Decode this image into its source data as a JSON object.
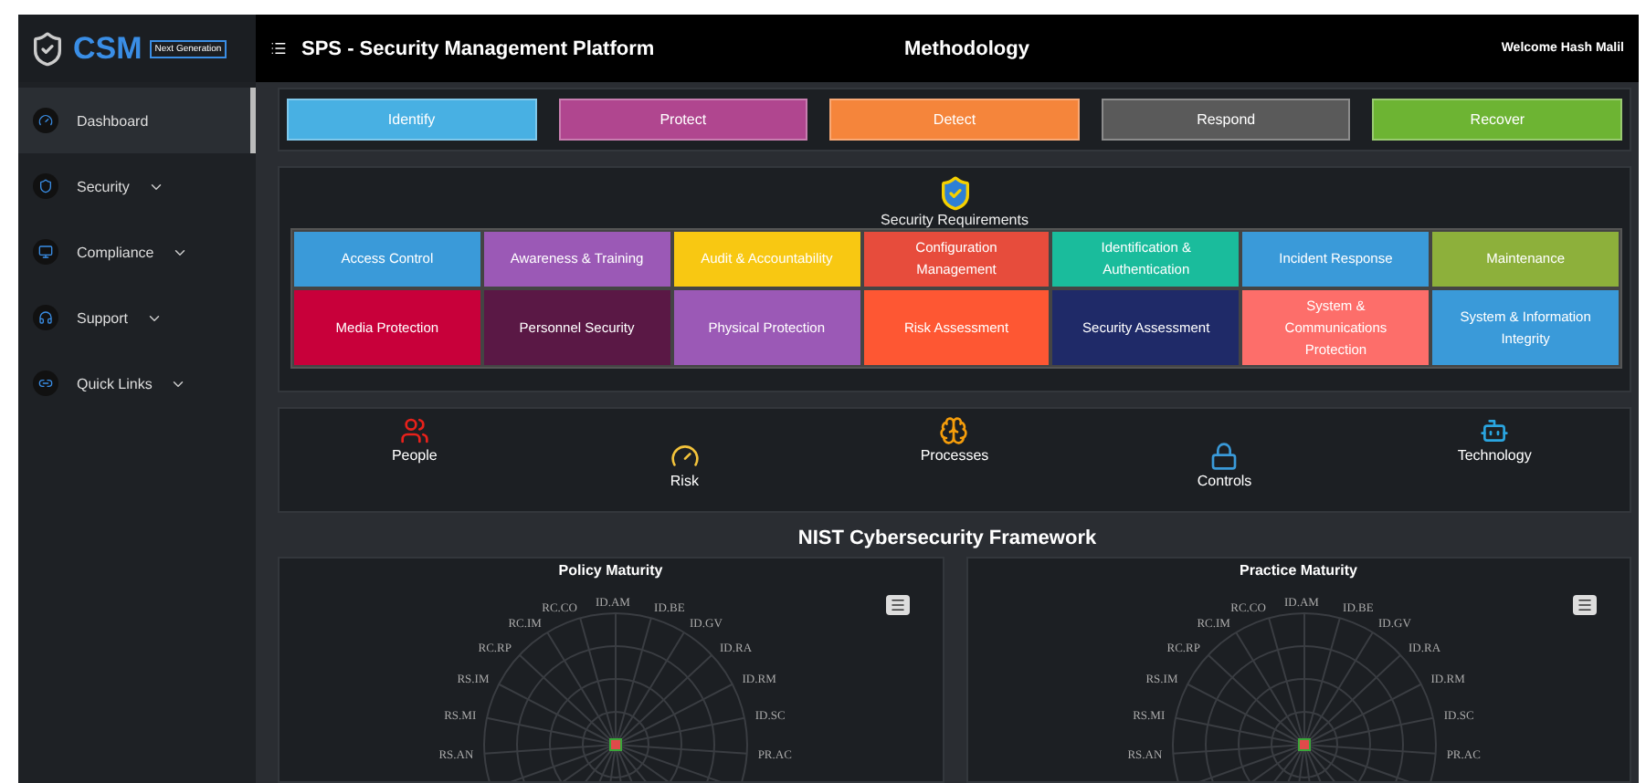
{
  "brand": {
    "name": "CSM",
    "tag": "Next Generation"
  },
  "header": {
    "title": "SPS - Security Management Platform",
    "center": "Methodology",
    "welcome": "Welcome Hash Malil"
  },
  "sidebar": {
    "items": [
      {
        "label": "Dashboard",
        "selected": true,
        "expandable": false
      },
      {
        "label": "Security",
        "selected": false,
        "expandable": true
      },
      {
        "label": "Compliance",
        "selected": false,
        "expandable": true
      },
      {
        "label": "Support",
        "selected": false,
        "expandable": true
      },
      {
        "label": "Quick Links",
        "selected": false,
        "expandable": true
      }
    ]
  },
  "functions": [
    {
      "label": "Identify",
      "color": "#48b0e3"
    },
    {
      "label": "Protect",
      "color": "#b0468f"
    },
    {
      "label": "Detect",
      "color": "#f5853b"
    },
    {
      "label": "Respond",
      "color": "#5a5a5a"
    },
    {
      "label": "Recover",
      "color": "#6db433"
    }
  ],
  "requirements": {
    "title": "Security Requirements",
    "items": [
      {
        "label": "Access Control",
        "color": "#3a9ad9"
      },
      {
        "label": "Awareness & Training",
        "color": "#9b59b6"
      },
      {
        "label": "Audit & Accountability",
        "color": "#f8c812"
      },
      {
        "label": "Configuration Management",
        "color": "#e74c3c"
      },
      {
        "label": "Identification & Authentication",
        "color": "#1abc9c"
      },
      {
        "label": "Incident Response",
        "color": "#3a9ad9"
      },
      {
        "label": "Maintenance",
        "color": "#8db03b"
      },
      {
        "label": "Media Protection",
        "color": "#c8003a"
      },
      {
        "label": "Personnel Security",
        "color": "#5a1845"
      },
      {
        "label": "Physical Protection",
        "color": "#9b59b6"
      },
      {
        "label": "Risk Assessment",
        "color": "#fe5733"
      },
      {
        "label": "Security Assessment",
        "color": "#1f2a68"
      },
      {
        "label": "System & Communications Protection",
        "color": "#fd6e6a"
      },
      {
        "label": "System & Information Integrity",
        "color": "#3a9ad9"
      }
    ]
  },
  "concepts": [
    {
      "label": "People"
    },
    {
      "label": "Risk"
    },
    {
      "label": "Processes"
    },
    {
      "label": "Controls"
    },
    {
      "label": "Technology"
    }
  ],
  "framework": {
    "title": "NIST Cybersecurity Framework",
    "charts": [
      {
        "title": "Policy Maturity",
        "axes_right": [
          "ID.AM",
          "ID.BE",
          "ID.GV",
          "ID.RA",
          "ID.RM",
          "ID.SC",
          "PR.AC"
        ],
        "axes_left": [
          "RC.CO",
          "RC.IM",
          "RC.RP",
          "RS.IM",
          "RS.MI",
          "RS.AN"
        ]
      },
      {
        "title": "Practice Maturity",
        "axes_right": [
          "ID.AM",
          "ID.BE",
          "ID.GV",
          "ID.RA",
          "ID.RM",
          "ID.SC",
          "PR.AC"
        ],
        "axes_left": [
          "RC.CO",
          "RC.IM",
          "RC.RP",
          "RS.IM",
          "RS.MI",
          "RS.AN"
        ]
      }
    ]
  }
}
